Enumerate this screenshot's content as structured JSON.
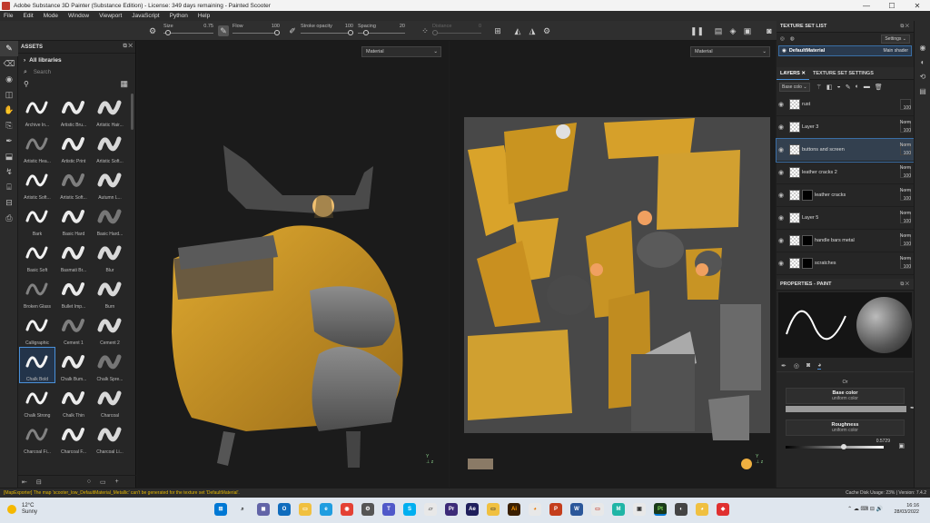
{
  "window": {
    "title": "Adobe Substance 3D Painter (Substance Edition) - License: 349 days remaining - Painted Scooter"
  },
  "menu": [
    "File",
    "Edit",
    "Mode",
    "Window",
    "Viewport",
    "JavaScript",
    "Python",
    "Help"
  ],
  "toolbar": {
    "size_label": "Size",
    "size_value": "0.75",
    "flow_label": "Flow",
    "flow_value": "100",
    "stroke_label": "Stroke opacity",
    "stroke_value": "100",
    "spacing_label": "Spacing",
    "spacing_value": "20",
    "distance_label": "Distance",
    "distance_value": "0"
  },
  "assets": {
    "title": "ASSETS",
    "library": "All libraries",
    "search_placeholder": "Search",
    "items": [
      "Archive In...",
      "Artistic Bru...",
      "Artistic Hair...",
      "Artistic Hea...",
      "Artistic Print",
      "Artistic Soft...",
      "Artistic Soft...",
      "Artistic Soft...",
      "Autumn L...",
      "Bark",
      "Basic Hard",
      "Basic Hard...",
      "Basic Soft",
      "Basmati Br...",
      "Blur",
      "Broken Glass",
      "Bullet Imp...",
      "Burn",
      "Calligraphic",
      "Cement 1",
      "Cement 2",
      "Chalk Bold",
      "Chalk Bum...",
      "Chalk Spre...",
      "Chalk Strong",
      "Chalk Thin",
      "Charcoal",
      "Charcoal Fi...",
      "Charcoal F...",
      "Charcoal Li..."
    ],
    "selected_index": 21
  },
  "viewport": {
    "material_3d": "Material",
    "material_2d": "Material"
  },
  "texture_set_list": {
    "title": "TEXTURE SET LIST",
    "settings_label": "Settings",
    "material_name": "DefaultMaterial",
    "shader": "Main shader"
  },
  "layers_panel": {
    "tab_layers": "LAYERS",
    "tab_tss": "TEXTURE SET SETTINGS",
    "channel": "Base colo",
    "layers": [
      {
        "name": "rust",
        "blend": "",
        "opacity": "100",
        "mask": false
      },
      {
        "name": "Layer 3",
        "blend": "Norm",
        "opacity": "100",
        "mask": false
      },
      {
        "name": "buttons and screen",
        "blend": "Norm",
        "opacity": "100",
        "mask": false
      },
      {
        "name": "leather cracks 2",
        "blend": "Norm",
        "opacity": "100",
        "mask": false
      },
      {
        "name": "leather cracks",
        "blend": "Norm",
        "opacity": "100",
        "mask": true
      },
      {
        "name": "Layer 5",
        "blend": "Norm",
        "opacity": "100",
        "mask": false
      },
      {
        "name": "handle bars metal",
        "blend": "Norm",
        "opacity": "100",
        "mask": true
      },
      {
        "name": "scratches",
        "blend": "Norm",
        "opacity": "100",
        "mask": true
      }
    ],
    "selected_index": 2
  },
  "properties": {
    "title": "PROPERTIES - PAINT",
    "channel_op": "Or",
    "base_color_title": "Base color",
    "base_color_sub": "uniform color",
    "roughness_title": "Roughness",
    "roughness_sub": "uniform color",
    "roughness_value": "0.5729"
  },
  "status": {
    "message": "[MapExporter] The map 'scooter_low_DefaultMaterial_Metallic' can't be generated for the texture set 'DefaultMaterial'.",
    "disk": "Cache Disk Usage: 23% | Version: 7.4.2"
  },
  "taskbar": {
    "temp": "12°C",
    "weather": "Sunny",
    "time": "16:16",
    "date": "28/03/2022"
  },
  "colors": {
    "accent": "#4a90d9",
    "warning": "#e6b800",
    "scooter_yellow": "#d8a020"
  }
}
